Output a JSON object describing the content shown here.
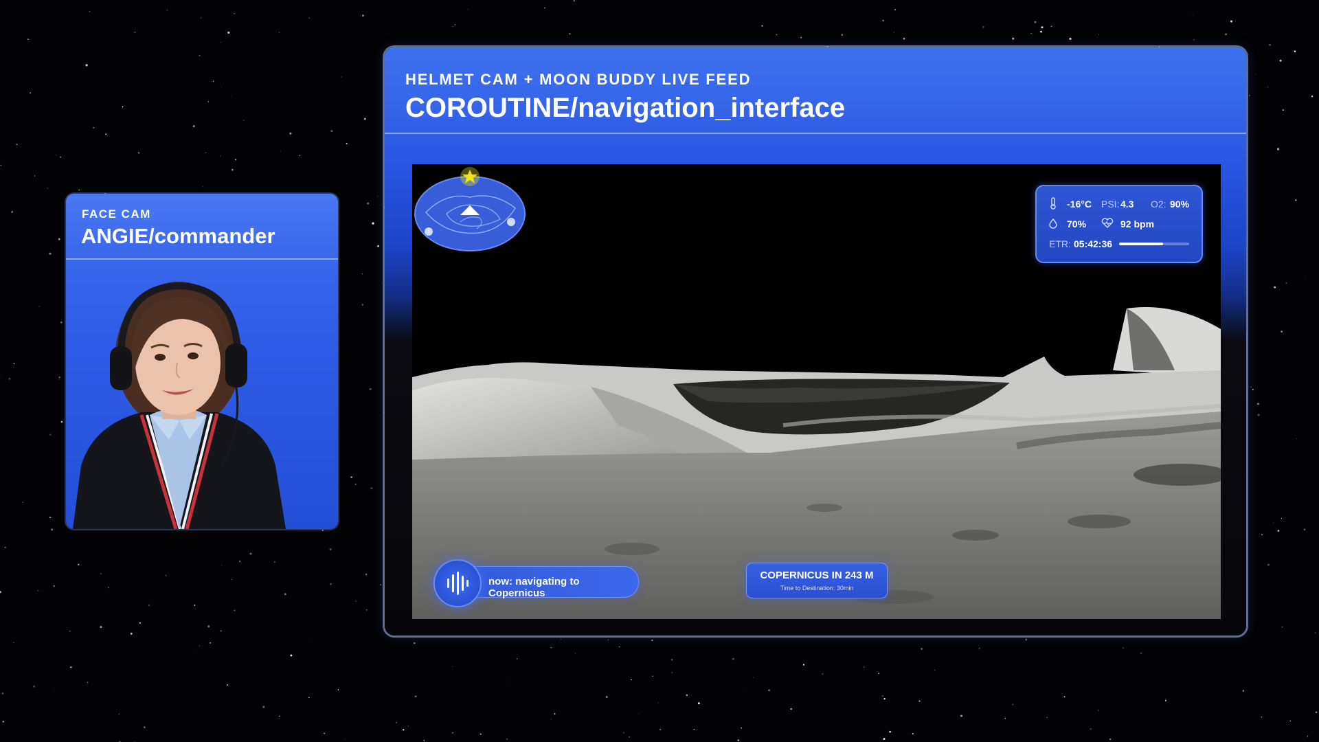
{
  "face_cam": {
    "tag": "FACE CAM",
    "title": "ANGIE/commander"
  },
  "helmet_cam": {
    "tag": "HELMET CAM  + MOON BUDDY LIVE FEED",
    "title": "COROUTINE/navigation_interface"
  },
  "telemetry": {
    "temperature": "-16°C",
    "psi_label": "PSI:",
    "psi_value": "4.3",
    "o2_label": "O2:",
    "o2_value": "90%",
    "humidity": "70%",
    "heart_rate": "92 bpm",
    "etr_label": "ETR:",
    "etr_value": "05:42:36",
    "etr_progress": 0.63
  },
  "voice": {
    "status": "now: navigating to Copernicus",
    "icon": "audio-wave-icon"
  },
  "destination": {
    "main": "COPERNICUS IN 243 M",
    "sub": "Time to Destination: 30min"
  },
  "minimap": {
    "target_icon": "star-icon",
    "player_icon": "triangle-icon"
  },
  "colors": {
    "accent": "#3f6ef0",
    "panel_dark": "#2347c2",
    "target": "#f2e21a",
    "space": "#030305"
  }
}
